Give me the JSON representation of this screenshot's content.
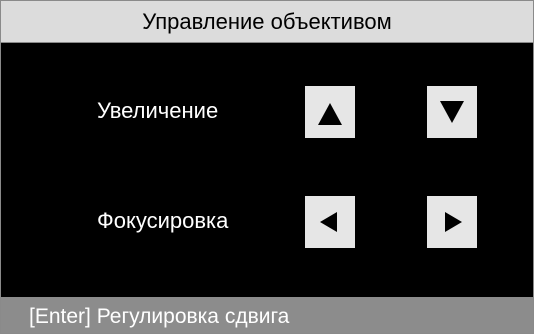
{
  "window": {
    "title": "Управление объективом"
  },
  "lens": {
    "zoom_label": "Увеличение",
    "focus_label": "Фокусировка",
    "buttons": {
      "zoom_in_icon": "triangle-up-icon",
      "zoom_out_icon": "triangle-down-icon",
      "focus_near_icon": "triangle-left-icon",
      "focus_far_icon": "triangle-right-icon"
    }
  },
  "status": {
    "hint": "[Enter] Регулировка сдвига"
  },
  "colors": {
    "title_bg": "#dcdcdc",
    "panel_bg": "#000000",
    "button_bg": "#e6e6e6",
    "status_bg": "#8c8c8c",
    "text_light": "#ffffff",
    "text_dark": "#000000"
  }
}
